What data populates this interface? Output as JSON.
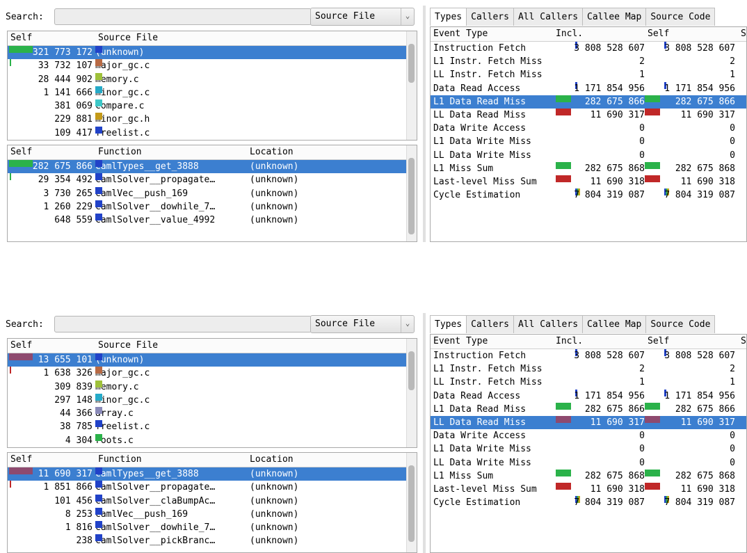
{
  "colors": {
    "selection": "#3c7fd0",
    "green": "#2bb24a",
    "red": "#c02828",
    "mauve": "#8e4a6f",
    "blue": "#2142c8"
  },
  "search": {
    "label": "Search:",
    "placeholder": ""
  },
  "source_select": {
    "value": "Source File"
  },
  "tabs": [
    "Types",
    "Callers",
    "All Callers",
    "Callee Map",
    "Source Code"
  ],
  "top": {
    "file_list": {
      "headers": {
        "self": "Self",
        "name": "Source File"
      },
      "rows": [
        {
          "self": "321 773 172",
          "name": "(unknown)",
          "color": "#2142c8",
          "bar": "green",
          "selected": true
        },
        {
          "self": "33 732 107",
          "name": "major_gc.c",
          "color": "#b86a44",
          "bar": "green-tick"
        },
        {
          "self": "28 444 902",
          "name": "memory.c",
          "color": "#9fc13a"
        },
        {
          "self": "1 141 666",
          "name": "minor_gc.c",
          "color": "#25aac8"
        },
        {
          "self": "381 069",
          "name": "compare.c",
          "color": "#3cc7c7"
        },
        {
          "self": "229 881",
          "name": "minor_gc.h",
          "color": "#c49a18"
        },
        {
          "self": "109 417",
          "name": "freelist.c",
          "color": "#2142c8"
        }
      ]
    },
    "func_list": {
      "headers": {
        "self": "Self",
        "name": "Function",
        "location": "Location"
      },
      "rows": [
        {
          "self": "282 675 866",
          "name": "camlTypes__get_3888",
          "loc": "(unknown)",
          "color": "#2142c8",
          "bar": "green",
          "selected": true
        },
        {
          "self": "29 354 492",
          "name": "camlSolver__propagate…",
          "loc": "(unknown)",
          "color": "#2142c8",
          "bar": "green-tick"
        },
        {
          "self": "3 730 265",
          "name": "camlVec__push_169",
          "loc": "(unknown)",
          "color": "#2142c8"
        },
        {
          "self": "1 260 229",
          "name": "camlSolver__dowhile_7…",
          "loc": "(unknown)",
          "color": "#2142c8"
        },
        {
          "self": "648 559",
          "name": "camlSolver__value_4992",
          "loc": "(unknown)",
          "color": "#2142c8"
        }
      ]
    },
    "types": {
      "headers": {
        "event": "Event Type",
        "incl": "Incl.",
        "self": "Self",
        "extra": "S"
      },
      "rows": [
        {
          "event": "Instruction Fetch",
          "incl": "3 808 528 607",
          "self": "3 808 528 607",
          "mark": "blue"
        },
        {
          "event": "L1 Instr. Fetch Miss",
          "incl": "2",
          "self": "2"
        },
        {
          "event": "LL Instr. Fetch Miss",
          "incl": "1",
          "self": "1"
        },
        {
          "event": "Data Read Access",
          "incl": "1 171 854 956",
          "self": "1 171 854 956",
          "mark": "blue"
        },
        {
          "event": "L1 Data Read Miss",
          "incl": "282 675 866",
          "self": "282 675 866",
          "mark": "green",
          "selected": true
        },
        {
          "event": "LL Data Read Miss",
          "incl": "11 690 317",
          "self": "11 690 317",
          "mark": "red"
        },
        {
          "event": "Data Write Access",
          "incl": "0",
          "self": "0"
        },
        {
          "event": "L1 Data Write Miss",
          "incl": "0",
          "self": "0"
        },
        {
          "event": "LL Data Write Miss",
          "incl": "0",
          "self": "0"
        },
        {
          "event": "L1 Miss Sum",
          "incl": "282 675 868",
          "self": "282 675 868",
          "mark": "green"
        },
        {
          "event": "Last-level Miss Sum",
          "incl": "11 690 318",
          "self": "11 690 318",
          "mark": "red"
        },
        {
          "event": "Cycle Estimation",
          "incl": "7 804 319 087",
          "self": "7 804 319 087",
          "mark": "multi"
        }
      ]
    }
  },
  "bottom": {
    "file_list": {
      "headers": {
        "self": "Self",
        "name": "Source File"
      },
      "rows": [
        {
          "self": "13 655 101",
          "name": "(unknown)",
          "color": "#2142c8",
          "bar": "mauve",
          "selected": true
        },
        {
          "self": "1 638 326",
          "name": "major_gc.c",
          "color": "#b86a44",
          "bar": "red-tick"
        },
        {
          "self": "309 839",
          "name": "memory.c",
          "color": "#9fc13a"
        },
        {
          "self": "297 148",
          "name": "minor_gc.c",
          "color": "#25aac8"
        },
        {
          "self": "44 366",
          "name": "array.c",
          "color": "#8a8ab8"
        },
        {
          "self": "38 785",
          "name": "freelist.c",
          "color": "#2142c8"
        },
        {
          "self": "4 304",
          "name": "roots.c",
          "color": "#2bb24a"
        }
      ]
    },
    "func_list": {
      "headers": {
        "self": "Self",
        "name": "Function",
        "location": "Location"
      },
      "rows": [
        {
          "self": "11 690 317",
          "name": "camlTypes__get_3888",
          "loc": "(unknown)",
          "color": "#2142c8",
          "bar": "mauve",
          "selected": true
        },
        {
          "self": "1 851 866",
          "name": "camlSolver__propagate…",
          "loc": "(unknown)",
          "color": "#2142c8",
          "bar": "red-tick"
        },
        {
          "self": "101 456",
          "name": "camlSolver__claBumpAc…",
          "loc": "(unknown)",
          "color": "#2142c8"
        },
        {
          "self": "8 253",
          "name": "camlVec__push_169",
          "loc": "(unknown)",
          "color": "#2142c8"
        },
        {
          "self": "1 816",
          "name": "camlSolver__dowhile_7…",
          "loc": "(unknown)",
          "color": "#2142c8"
        },
        {
          "self": "238",
          "name": "camlSolver__pickBranc…",
          "loc": "(unknown)",
          "color": "#2142c8"
        }
      ]
    },
    "types": {
      "headers": {
        "event": "Event Type",
        "incl": "Incl.",
        "self": "Self",
        "extra": "S"
      },
      "rows": [
        {
          "event": "Instruction Fetch",
          "incl": "3 808 528 607",
          "self": "3 808 528 607",
          "mark": "blue"
        },
        {
          "event": "L1 Instr. Fetch Miss",
          "incl": "2",
          "self": "2"
        },
        {
          "event": "LL Instr. Fetch Miss",
          "incl": "1",
          "self": "1"
        },
        {
          "event": "Data Read Access",
          "incl": "1 171 854 956",
          "self": "1 171 854 956",
          "mark": "blue"
        },
        {
          "event": "L1 Data Read Miss",
          "incl": "282 675 866",
          "self": "282 675 866",
          "mark": "green"
        },
        {
          "event": "LL Data Read Miss",
          "incl": "11 690 317",
          "self": "11 690 317",
          "mark": "mauve",
          "selected": true
        },
        {
          "event": "Data Write Access",
          "incl": "0",
          "self": "0"
        },
        {
          "event": "L1 Data Write Miss",
          "incl": "0",
          "self": "0"
        },
        {
          "event": "LL Data Write Miss",
          "incl": "0",
          "self": "0"
        },
        {
          "event": "L1 Miss Sum",
          "incl": "282 675 868",
          "self": "282 675 868",
          "mark": "green"
        },
        {
          "event": "Last-level Miss Sum",
          "incl": "11 690 318",
          "self": "11 690 318",
          "mark": "red"
        },
        {
          "event": "Cycle Estimation",
          "incl": "7 804 319 087",
          "self": "7 804 319 087",
          "mark": "multi"
        }
      ]
    }
  }
}
